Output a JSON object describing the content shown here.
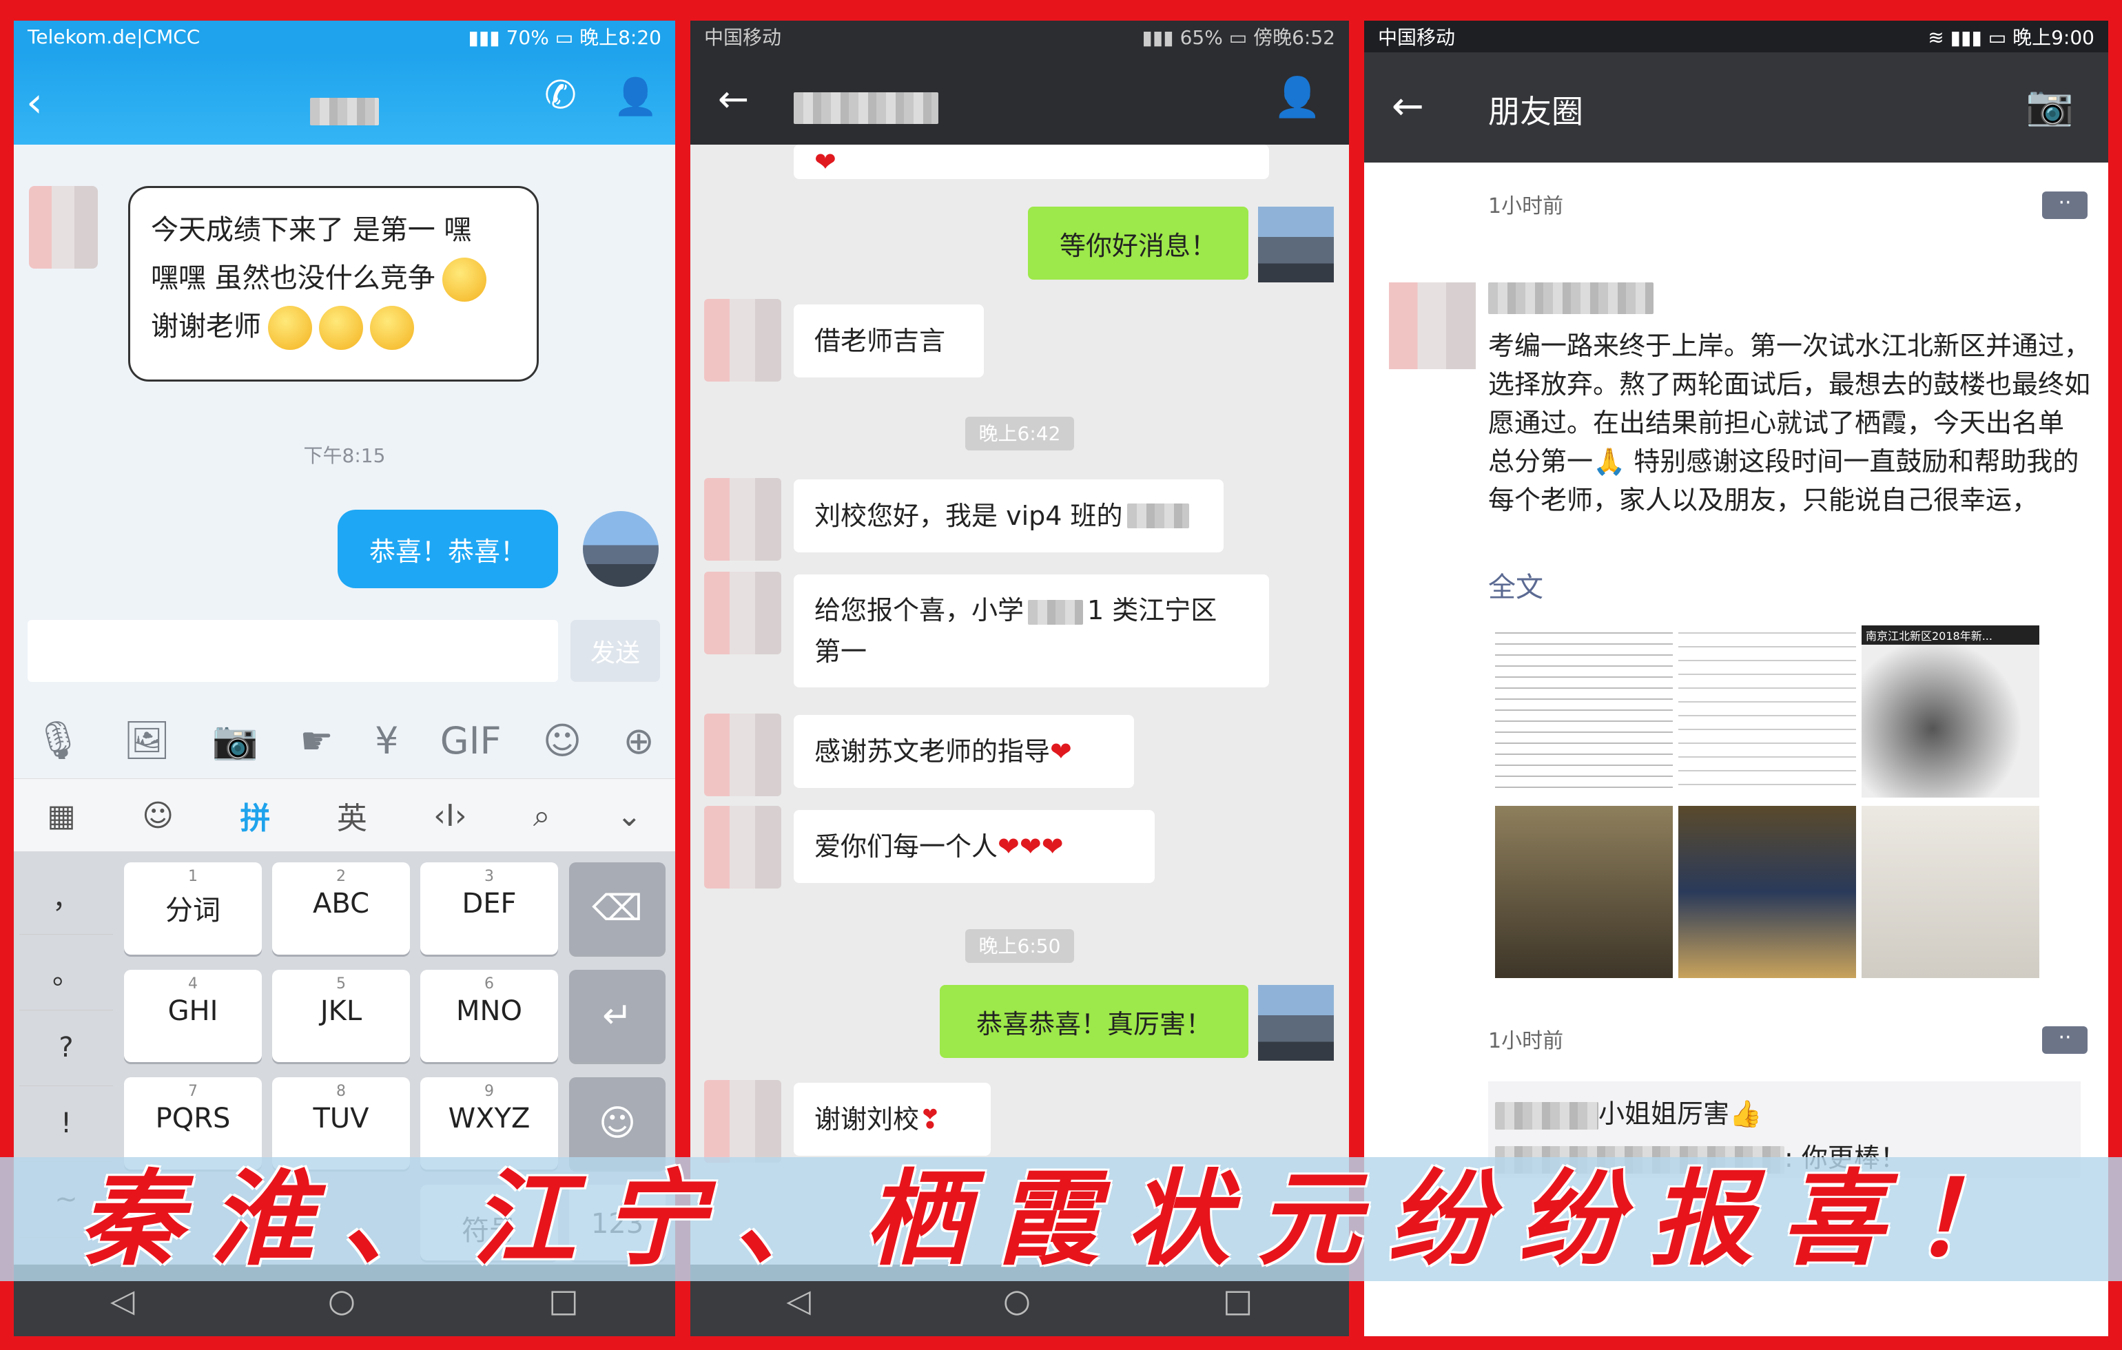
{
  "panel1": {
    "status": {
      "carrier": "Telekom.de|CMCC",
      "battery": "70%",
      "time": "晚上8:20"
    },
    "card_lines": [
      "今天成绩下来了 是第一 嘿",
      "嘿嘿 虽然也没什么竞争",
      "谢谢老师"
    ],
    "time_label": "下午8:15",
    "sent_message": "恭喜！恭喜！",
    "send_label": "发送",
    "ime": {
      "pinyin": "拼",
      "english": "英"
    },
    "punct": [
      "，",
      "。",
      "?",
      "!",
      "~"
    ],
    "keys": [
      {
        "num": "1",
        "label": "分词"
      },
      {
        "num": "2",
        "label": "ABC"
      },
      {
        "num": "3",
        "label": "DEF"
      },
      {
        "num": "4",
        "label": "GHI"
      },
      {
        "num": "5",
        "label": "JKL"
      },
      {
        "num": "6",
        "label": "MNO"
      },
      {
        "num": "7",
        "label": "PQRS"
      },
      {
        "num": "8",
        "label": "TUV"
      },
      {
        "num": "9",
        "label": "WXYZ"
      }
    ],
    "bottom_keys": {
      "symbol": "符号",
      "num": "123"
    }
  },
  "panel2": {
    "status": {
      "carrier": "中国移动",
      "battery": "65%",
      "time": "傍晚6:52"
    },
    "messages": {
      "m1": "等你好消息！",
      "m2": "借老师吉言",
      "t1": "晚上6:42",
      "m3": "刘校您好，我是 vip4 班的",
      "m4a": "给您报个喜，小学",
      "m4b": "1 类江宁区",
      "m4c": "第一",
      "m5": "感谢苏文老师的指导",
      "m6": "爱你们每一个人",
      "t2": "晚上6:50",
      "m7": "恭喜恭喜！真厉害！",
      "m8": "谢谢刘校"
    }
  },
  "panel3": {
    "status": {
      "carrier": "中国移动",
      "time": "晚上9:00"
    },
    "title": "朋友圈",
    "ago1": "1小时前",
    "ago2": "1小时前",
    "post_text": "考编一路来终于上岸。第一次试水江北新区并通过，选择放弃。熬了两轮面试后，最想去的鼓楼也最终如愿通过。在出结果前担心就试了栖霞，今天出名单 总分第一🙏 特别感谢这段时间一直鼓励和帮助我的每个老师，家人以及朋友，只能说自己很幸运，",
    "more": "全文",
    "comment1": "小姐姐厉害",
    "comment2": ": 你更棒！",
    "thumb_caption": "南京江北新区2018年新..."
  },
  "banner": "秦淮、江宁、栖霞状元纷纷报喜！"
}
